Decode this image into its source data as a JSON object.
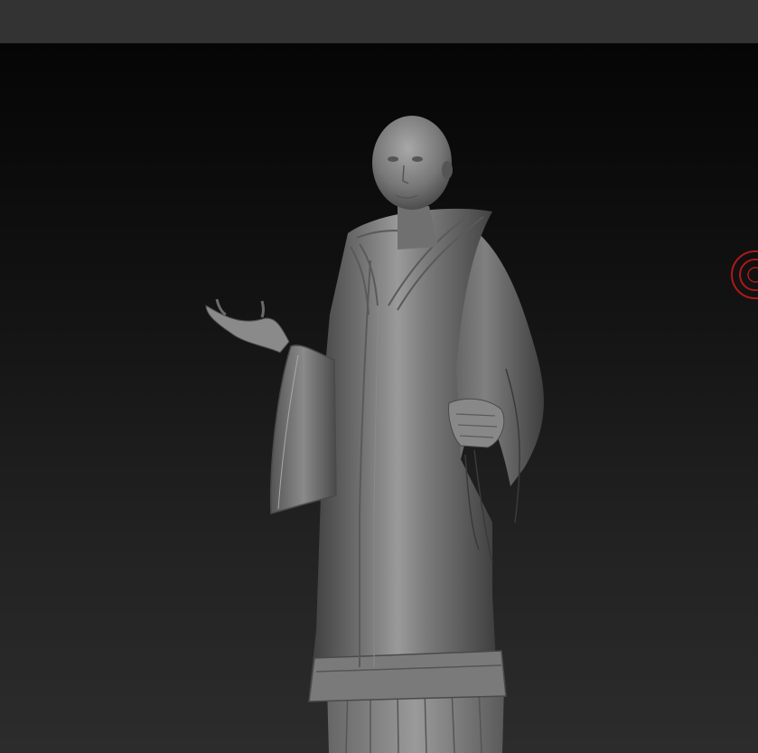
{
  "app": {
    "name": "sculpt-viewport"
  },
  "viewport": {
    "background_top": "#050505",
    "background_bottom": "#2c2c2c",
    "model": "robed-figure-sculpt"
  },
  "colors": {
    "topbar": "#333333",
    "gizmo_ring": "#b01818",
    "clay_light": "#9a9a9a",
    "clay_mid": "#6a6a6a",
    "clay_dark": "#3a3a3a"
  },
  "icons": {
    "navigation_gizmo": "rotate-gizmo-icon"
  }
}
